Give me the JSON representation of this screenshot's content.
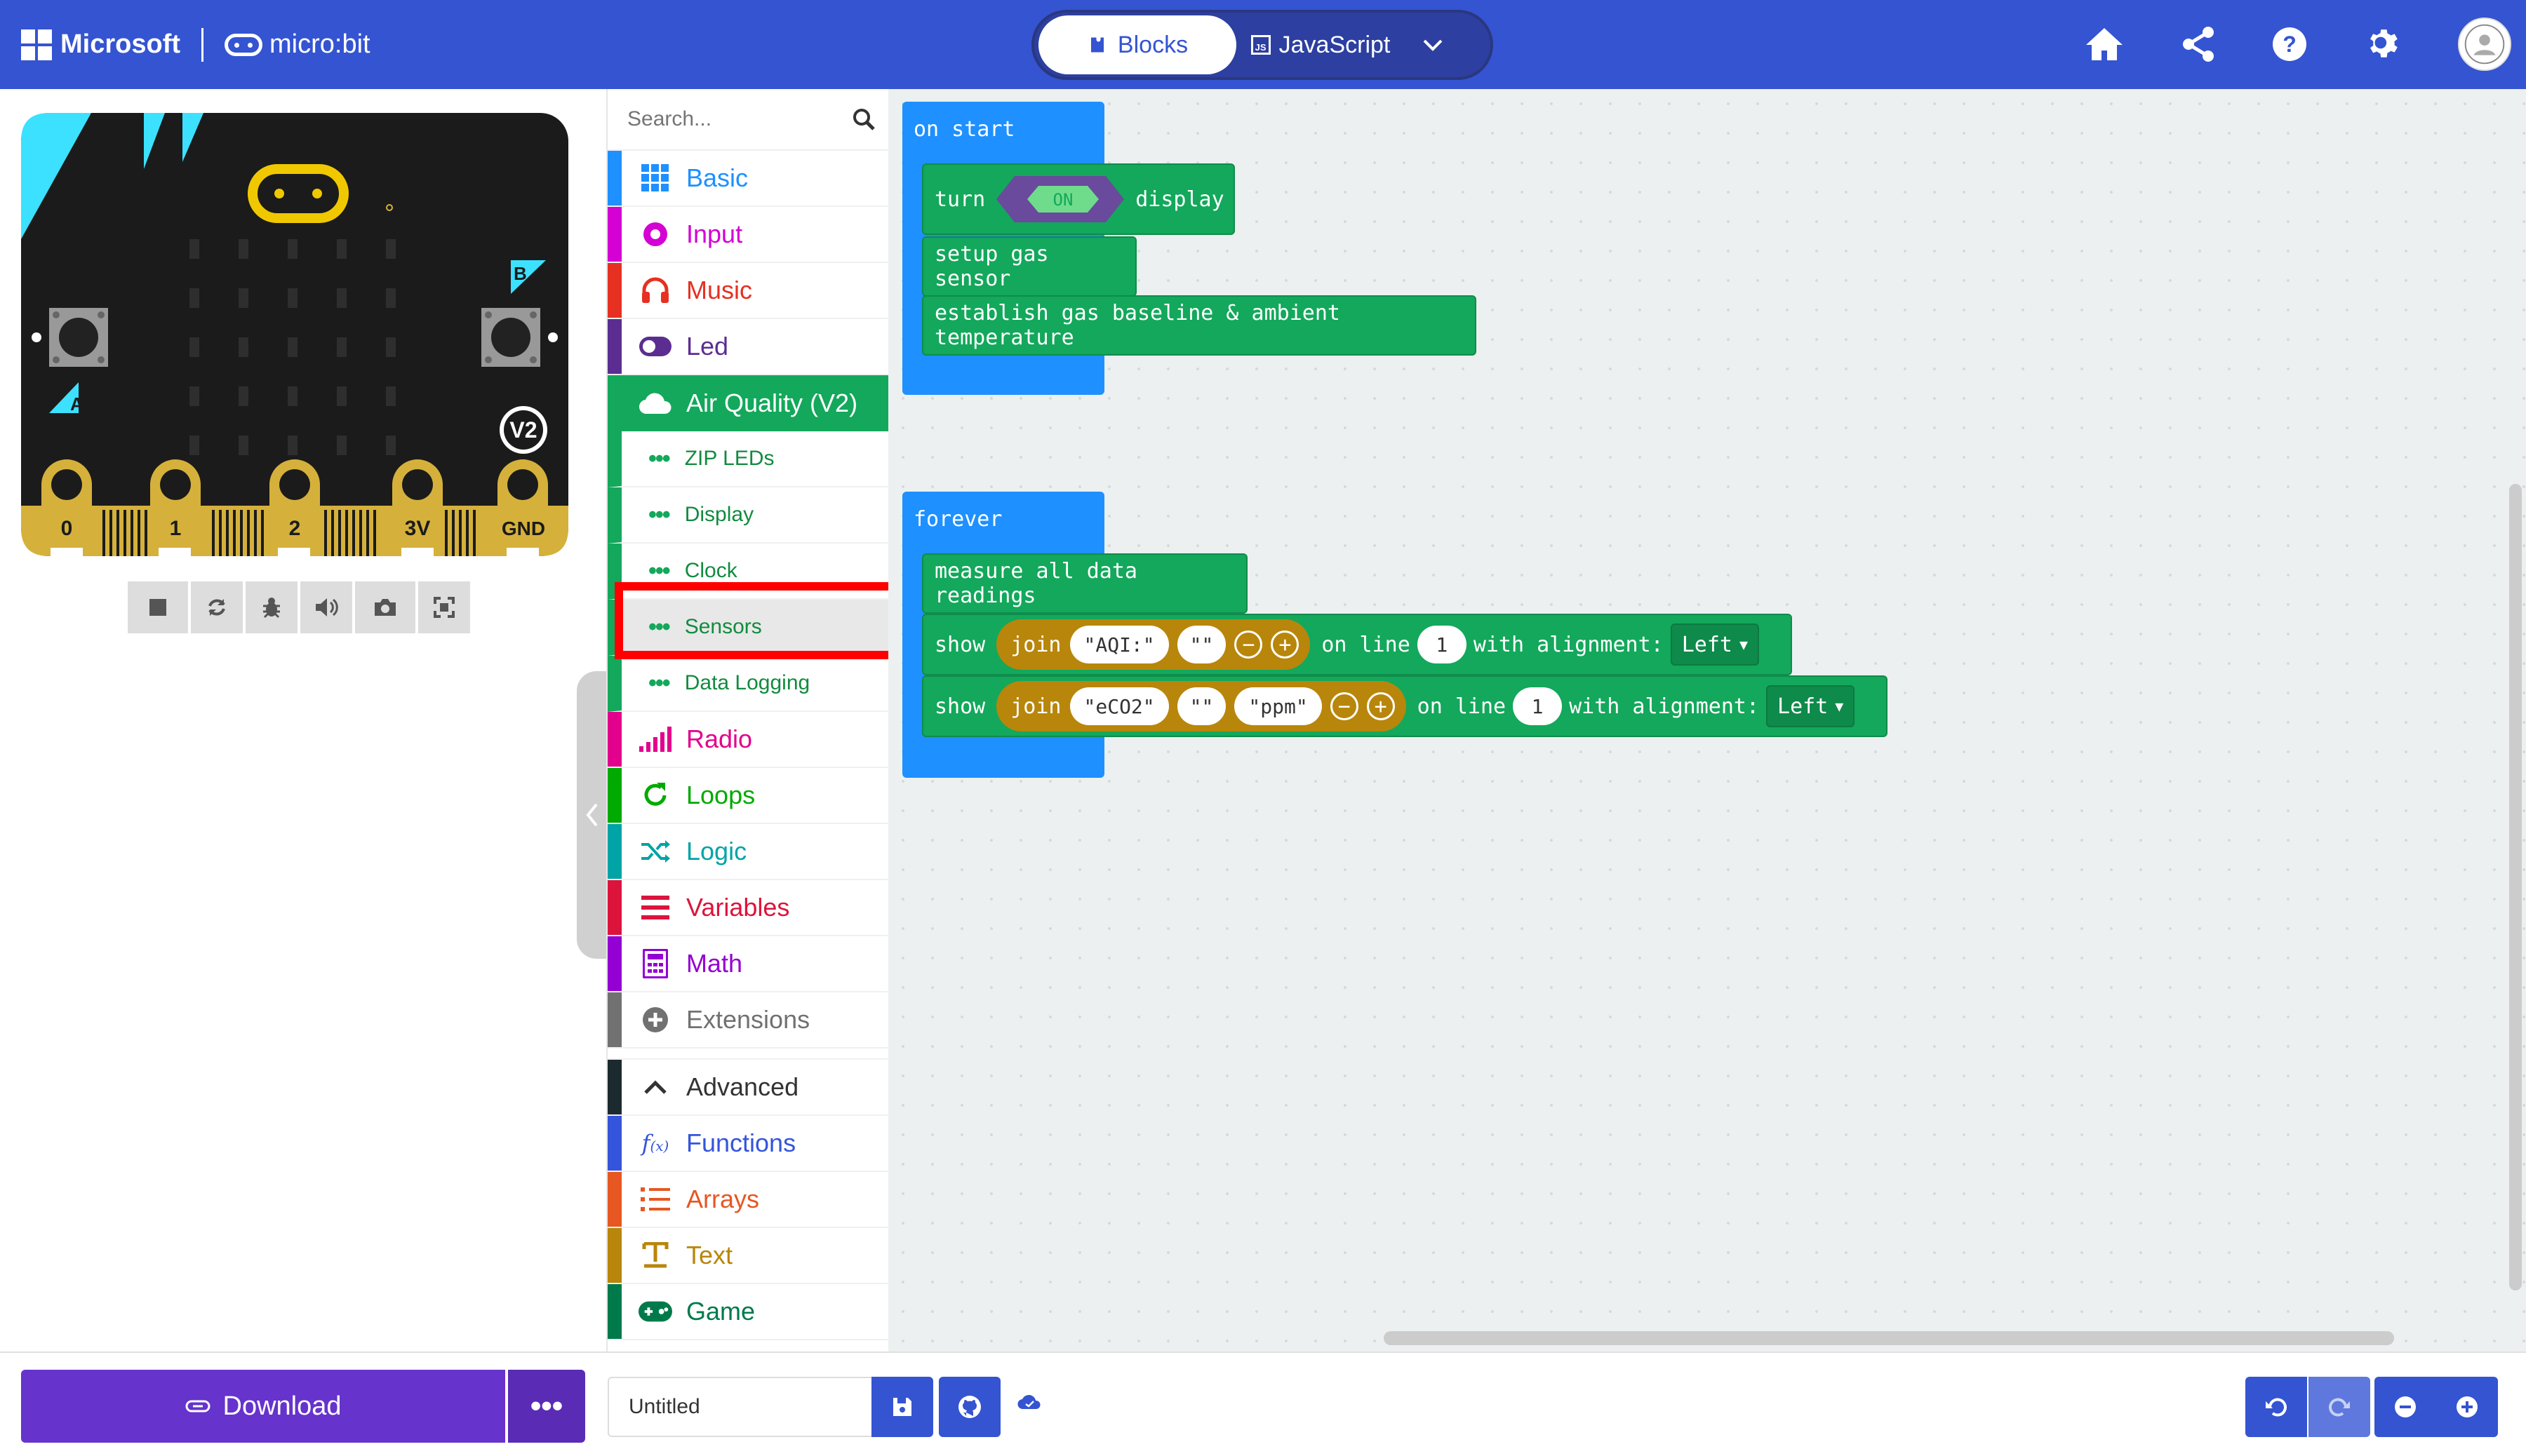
{
  "header": {
    "microsoft_label": "Microsoft",
    "product_label": "micro:bit",
    "mode_blocks": "Blocks",
    "mode_javascript": "JavaScript",
    "js_badge": "JS",
    "icons": [
      "home-icon",
      "share-icon",
      "help-icon",
      "settings-icon",
      "user-avatar"
    ]
  },
  "simulator": {
    "badge": "V2",
    "button_a": "A",
    "button_b": "B",
    "pins": [
      "0",
      "1",
      "2",
      "3V",
      "GND"
    ],
    "board_color": "#1b1b1b",
    "accent_color": "#3ce1ff",
    "pin_color": "#d5b13b",
    "controls": [
      "stop-icon",
      "restart-icon",
      "debug-icon",
      "mute-icon",
      "screenshot-icon",
      "fullscreen-icon"
    ]
  },
  "toolbox": {
    "search_placeholder": "Search...",
    "categories": [
      {
        "label": "Basic",
        "color": "#1e90ff"
      },
      {
        "label": "Input",
        "color": "#d400d4"
      },
      {
        "label": "Music",
        "color": "#e63022"
      },
      {
        "label": "Led",
        "color": "#5c2d91"
      },
      {
        "label": "Air Quality (V2)",
        "color": "#13a85b"
      }
    ],
    "subcategories": [
      "ZIP LEDs",
      "Display",
      "Clock",
      "Sensors",
      "Data Logging"
    ],
    "categories2": [
      {
        "label": "Radio",
        "color": "#e3008c"
      },
      {
        "label": "Loops",
        "color": "#00aa00"
      },
      {
        "label": "Logic",
        "color": "#00a4a6"
      },
      {
        "label": "Variables",
        "color": "#dc143c"
      },
      {
        "label": "Math",
        "color": "#9400d3"
      },
      {
        "label": "Extensions",
        "color": "#717171"
      }
    ],
    "categories3": [
      {
        "label": "Advanced",
        "color": "#333333"
      },
      {
        "label": "Functions",
        "color": "#3455db"
      },
      {
        "label": "Arrays",
        "color": "#e65722"
      },
      {
        "label": "Text",
        "color": "#b8860b"
      },
      {
        "label": "Game",
        "color": "#007a4b"
      }
    ]
  },
  "workspace": {
    "on_start": {
      "hat": "on start",
      "turn": "turn",
      "toggle": "ON",
      "display": "display",
      "setup": "setup gas sensor",
      "baseline": "establish gas baseline & ambient temperature"
    },
    "forever": {
      "hat": "forever",
      "measure": "measure all data readings",
      "show1": {
        "show": "show",
        "join": "join",
        "str1": "AQI:",
        "str2": " ",
        "online": "on line",
        "line": "1",
        "align": "with alignment:",
        "dd": "Left"
      },
      "show2": {
        "show": "show",
        "join": "join",
        "str1": "eCO2",
        "str2": " ",
        "str3": "ppm",
        "online": "on line",
        "line": "1",
        "align": "with alignment:",
        "dd": "Left"
      }
    }
  },
  "bottom": {
    "download": "Download",
    "project_name": "Untitled"
  }
}
